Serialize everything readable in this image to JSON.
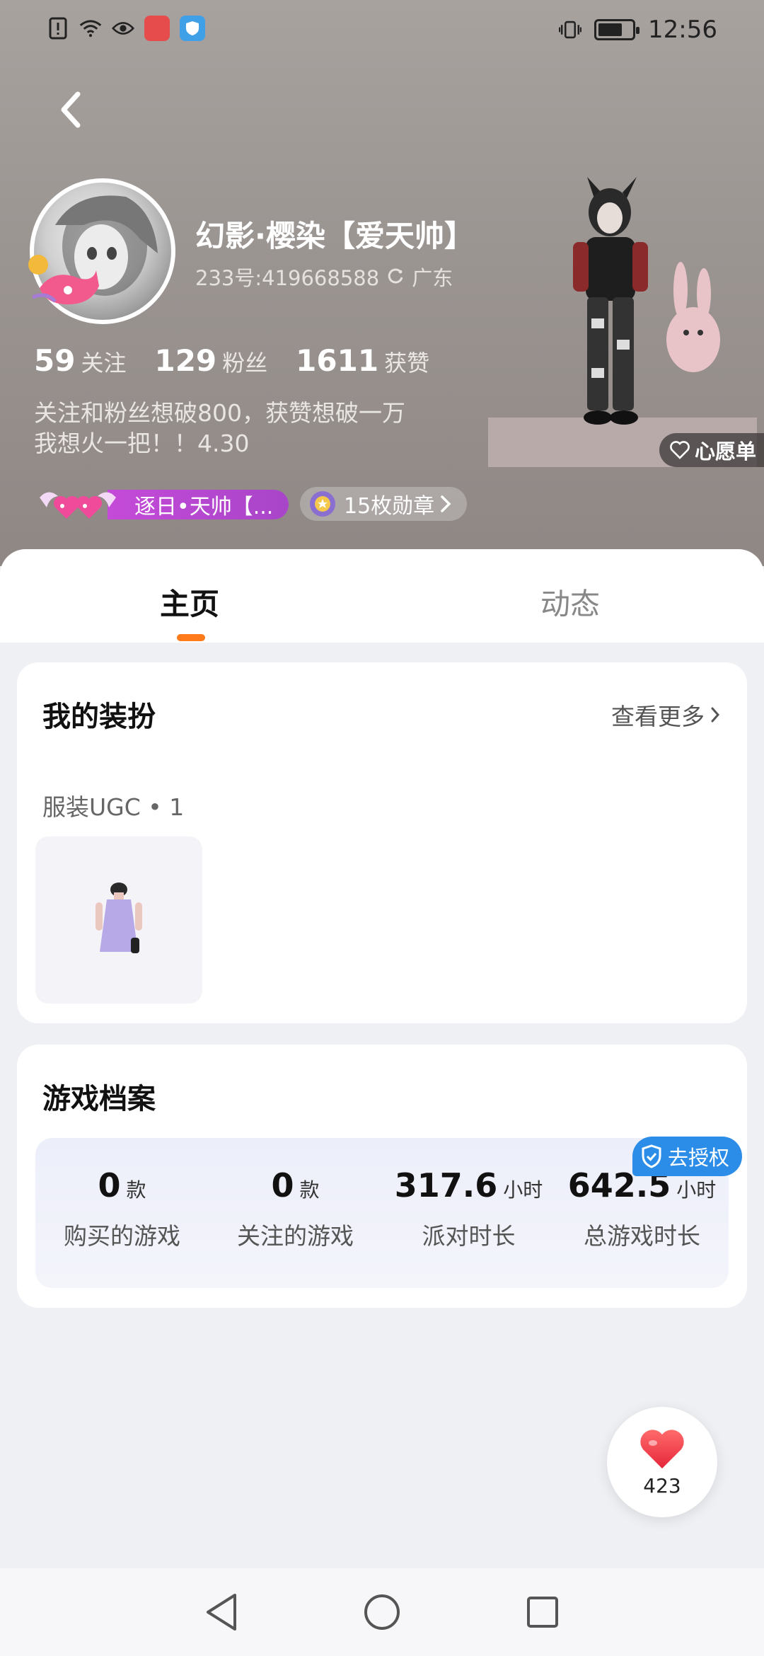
{
  "status_bar": {
    "time": "12:56",
    "battery_level": 0.75,
    "left_icons": [
      "alert-icon",
      "wifi-icon",
      "eye-icon",
      "huawei-app-icon",
      "shield-app-icon"
    ],
    "right_icons": [
      "vibrate-icon",
      "battery-icon"
    ]
  },
  "profile": {
    "nickname": "幻影·樱染【爱天帅】",
    "id_text": "233号:419668588",
    "location": "广东",
    "stats": [
      {
        "num": "59",
        "label": "关注"
      },
      {
        "num": "129",
        "label": "粉丝"
      },
      {
        "num": "1611",
        "label": "获赞"
      }
    ],
    "bio": "关注和粉丝想破800，获赞想破一万\n我想火一把！！4.30",
    "wishlist_label": "心愿单",
    "title_badge": "逐日•天帅【...",
    "medals_label": "15枚勋章"
  },
  "tabs": [
    {
      "label": "主页",
      "active": true
    },
    {
      "label": "动态",
      "active": false
    }
  ],
  "outfit_card": {
    "title": "我的装扮",
    "see_more": "查看更多",
    "category": "服装UGC • 1"
  },
  "game_card": {
    "title": "游戏档案",
    "auth_label": "去授权",
    "stats": [
      {
        "value": "0",
        "unit": "款",
        "label": "购买的游戏"
      },
      {
        "value": "0",
        "unit": "款",
        "label": "关注的游戏"
      },
      {
        "value": "317.6",
        "unit": "小时",
        "label": "派对时长"
      },
      {
        "value": "642.5",
        "unit": "小时",
        "label": "总游戏时长"
      }
    ]
  },
  "like_button": {
    "count": "423"
  },
  "colors": {
    "accent": "#ff7a1a",
    "auth_blue": "#2b8de8",
    "title_badge_purple": "#b447cf",
    "like_red": "#f2394a"
  }
}
